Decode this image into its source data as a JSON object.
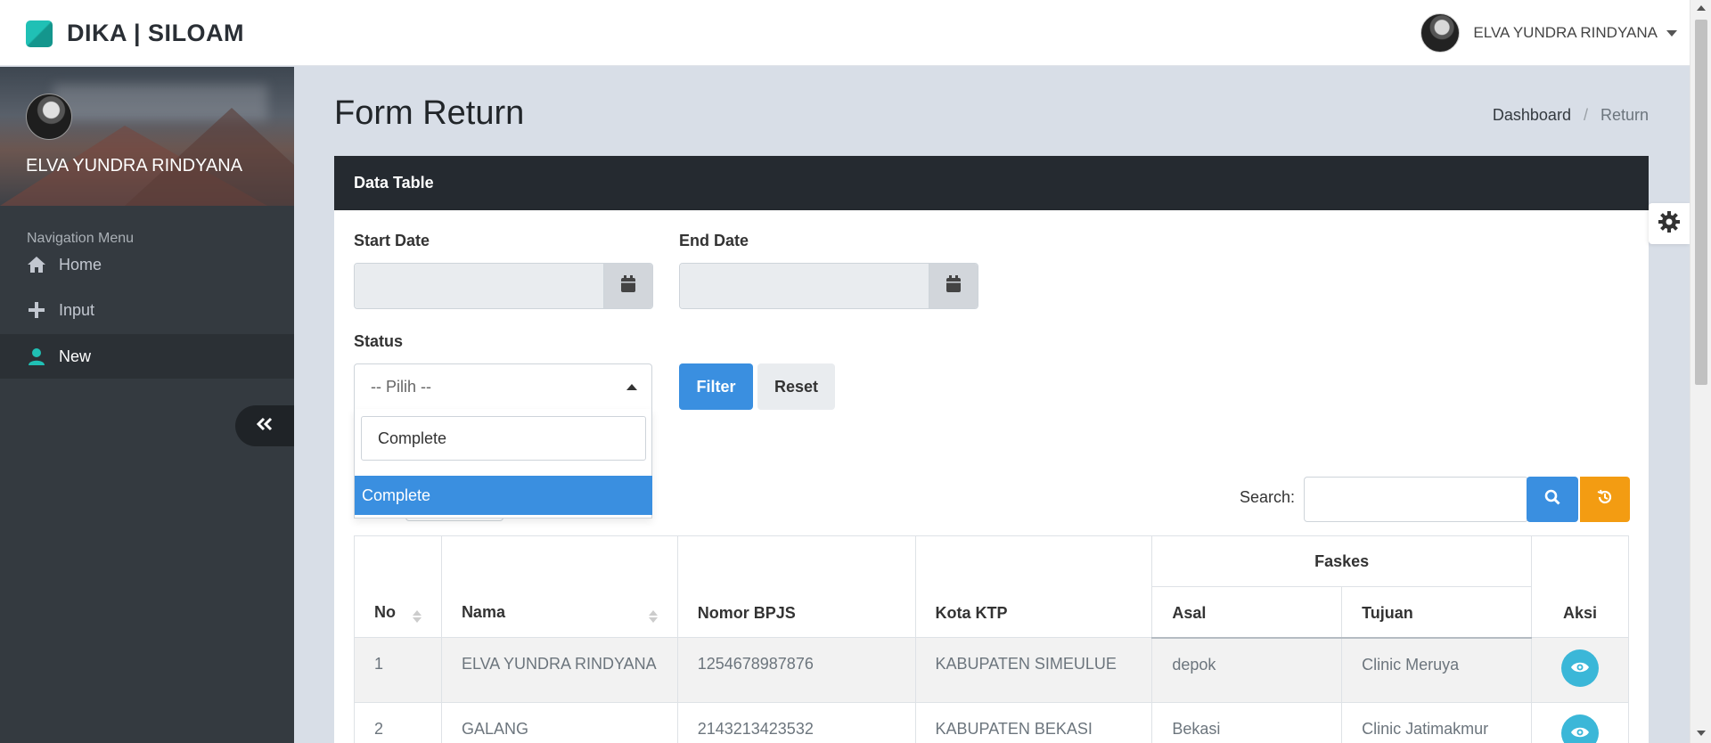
{
  "app": {
    "brand": "DIKA | SILOAM",
    "user_name": "ELVA YUNDRA RINDYANA"
  },
  "sidebar": {
    "user_name": "ELVA YUNDRA RINDYANA",
    "nav_header": "Navigation Menu",
    "items": [
      {
        "label": "Home",
        "icon": "home-icon"
      },
      {
        "label": "Input",
        "icon": "plus-icon"
      },
      {
        "label": "New",
        "icon": "user-icon",
        "active": true
      }
    ]
  },
  "page": {
    "title": "Form Return",
    "breadcrumb": [
      "Dashboard",
      "Return"
    ]
  },
  "card": {
    "header": "Data Table",
    "start_date_label": "Start Date",
    "end_date_label": "End Date",
    "status_label": "Status",
    "status_placeholder": "-- Pilih --",
    "dropdown_search_value": "Complete",
    "dropdown_options": [
      "Complete"
    ],
    "filter_label": "Filter",
    "reset_label": "Reset",
    "search_label": "Search:"
  },
  "table": {
    "headers": {
      "no": "No",
      "nama": "Nama",
      "nomor_bpjs": "Nomor BPJS",
      "kota_ktp": "Kota KTP",
      "faskes": "Faskes",
      "asal": "Asal",
      "tujuan": "Tujuan",
      "aksi": "Aksi"
    },
    "rows": [
      {
        "no": "1",
        "nama": "ELVA YUNDRA RINDYANA",
        "nomor_bpjs": "1254678987876",
        "kota_ktp": "KABUPATEN SIMEULUE",
        "asal": "depok",
        "tujuan": "Clinic Meruya"
      },
      {
        "no": "2",
        "nama": "GALANG",
        "nomor_bpjs": "2143213423532",
        "kota_ktp": "KABUPATEN BEKASI",
        "asal": "Bekasi",
        "tujuan": "Clinic Jatimakmur"
      }
    ]
  },
  "colors": {
    "primary": "#3a8fe0",
    "warning": "#f39c12",
    "info": "#3bb7d8",
    "sidebar": "#343a40",
    "accent": "#20c0b5"
  }
}
